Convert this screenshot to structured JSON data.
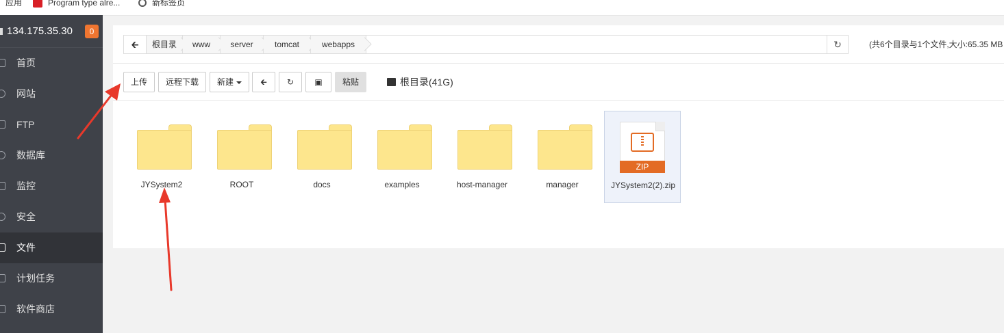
{
  "bookmarks": {
    "apps": "应用",
    "program": "Program type alre...",
    "newtab": "新标签页"
  },
  "sidebar": {
    "server_ip": "134.175.35.30",
    "badge": "0",
    "items": [
      {
        "label": "首页",
        "icon": "home-icon"
      },
      {
        "label": "网站",
        "icon": "globe-icon"
      },
      {
        "label": "FTP",
        "icon": "ftp-icon"
      },
      {
        "label": "数据库",
        "icon": "database-icon"
      },
      {
        "label": "监控",
        "icon": "monitor-icon"
      },
      {
        "label": "安全",
        "icon": "shield-icon"
      },
      {
        "label": "文件",
        "icon": "folder-icon",
        "active": true
      },
      {
        "label": "计划任务",
        "icon": "calendar-icon"
      },
      {
        "label": "软件商店",
        "icon": "grid-icon"
      }
    ]
  },
  "path": {
    "crumbs": [
      "根目录",
      "www",
      "server",
      "tomcat",
      "webapps"
    ],
    "info": "(共6个目录与1个文件,大小:65.35 MB"
  },
  "toolbar": {
    "upload": "上传",
    "remote_download": "远程下载",
    "new": "新建",
    "paste": "粘贴",
    "disk": "根目录(41G)"
  },
  "files": [
    {
      "name": "JYSystem2",
      "type": "folder"
    },
    {
      "name": "ROOT",
      "type": "folder"
    },
    {
      "name": "docs",
      "type": "folder"
    },
    {
      "name": "examples",
      "type": "folder"
    },
    {
      "name": "host-manager",
      "type": "folder"
    },
    {
      "name": "manager",
      "type": "folder"
    },
    {
      "name": "JYSystem2(2).zip",
      "type": "zip",
      "badge": "ZIP",
      "selected": true
    }
  ],
  "colors": {
    "sidebar_bg": "#3f4249",
    "badge": "#ef7530",
    "folder": "#fde68d",
    "zip": "#e36b24",
    "annotation": "#e8392b"
  }
}
